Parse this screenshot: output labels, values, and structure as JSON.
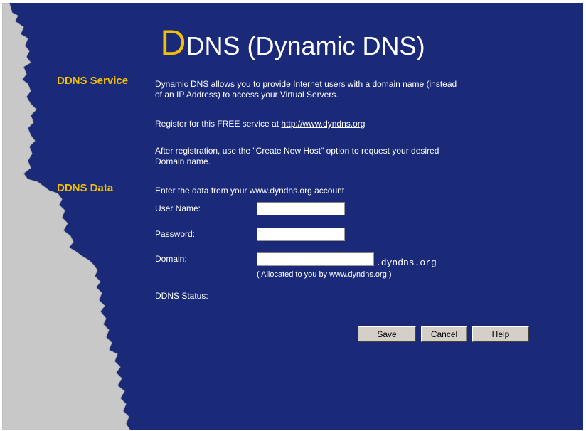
{
  "page_title": {
    "first_letter": "D",
    "rest": "DNS (Dynamic DNS)"
  },
  "ddns_service": {
    "heading": "DDNS Service",
    "description_line1": "Dynamic DNS allows you to provide Internet users with a domain name (instead",
    "description_line2": "of an IP Address) to access your Virtual Servers.",
    "register_text": "Register for this FREE service at ",
    "register_link": "http://www.dyndns.org",
    "after_line1": "After registration, use the \"Create New Host\" option to request your desired",
    "after_line2": "Domain name."
  },
  "ddns_data": {
    "heading": "DDNS Data",
    "intro": "Enter the data from your www.dyndns.org account",
    "user_name_label": "User Name:",
    "user_name_value": "",
    "password_label": "Password:",
    "password_value": "",
    "domain_label": "Domain:",
    "domain_value": "",
    "domain_suffix": ".dyndns.org",
    "domain_note": "( Allocated to you by www.dyndns.org )",
    "status_label": "DDNS Status:",
    "status_value": ""
  },
  "buttons": {
    "save": "Save",
    "cancel": "Cancel",
    "help": "Help"
  },
  "colors": {
    "background": "#1a2a78",
    "heading": "#f3c000",
    "text": "#ffffff"
  }
}
